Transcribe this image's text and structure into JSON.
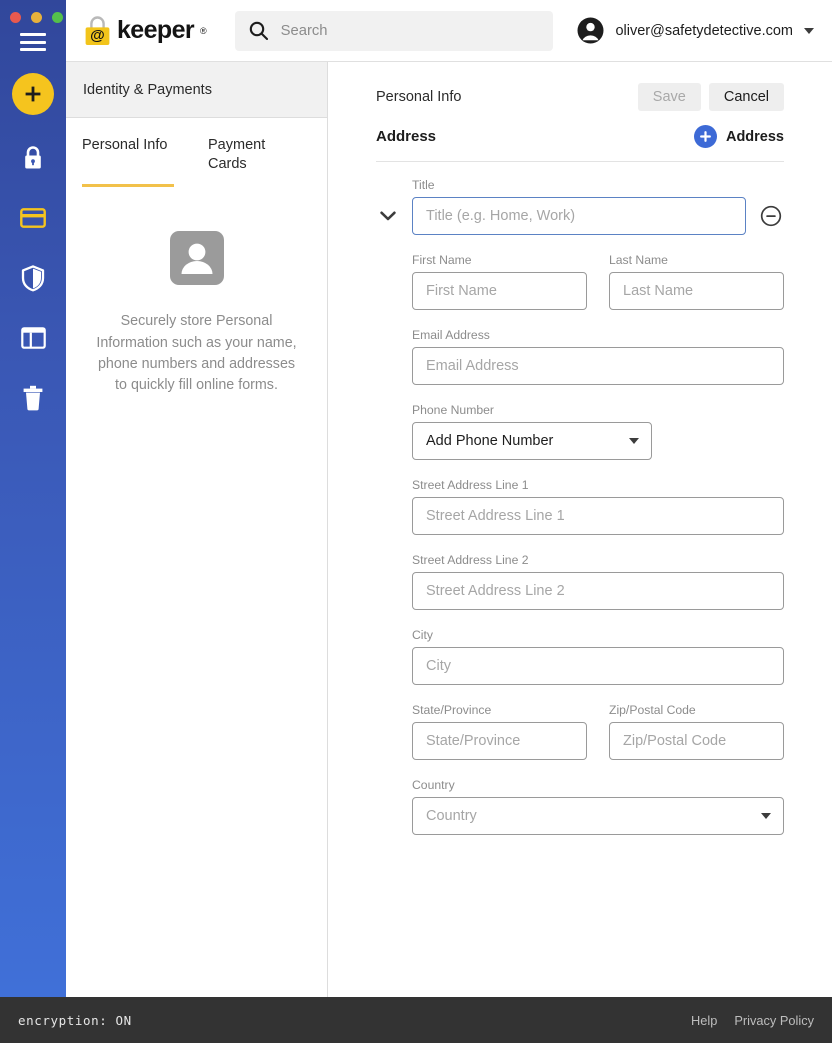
{
  "window": {
    "traffic_lights": [
      "close",
      "minimize",
      "zoom"
    ]
  },
  "topbar": {
    "logo_text": "keeper",
    "logo_registered": "®",
    "logo_icon": "padlock-at-icon",
    "search": {
      "icon": "search-icon",
      "placeholder": "Search",
      "value": ""
    },
    "account": {
      "icon": "user-avatar-icon",
      "email": "oliver@safetydetective.com",
      "caret": "chevron-down-icon"
    }
  },
  "rail": {
    "menu_icon": "hamburger-menu-icon",
    "add_button": {
      "icon": "plus-icon",
      "color": "#f5c41e"
    },
    "items": [
      {
        "icon": "lock-icon",
        "name": "passwords",
        "active": false
      },
      {
        "icon": "credit-card-icon",
        "name": "identity-payments",
        "active": true
      },
      {
        "icon": "shield-icon",
        "name": "security-audit",
        "active": false
      },
      {
        "icon": "dashboard-panel-icon",
        "name": "dashboard",
        "active": false
      },
      {
        "icon": "trash-icon",
        "name": "deleted-items",
        "active": false
      }
    ],
    "accent_color": "#f5c41e"
  },
  "list_panel": {
    "header": "Identity & Payments",
    "tabs": [
      {
        "label": "Personal Info",
        "active": true
      },
      {
        "label": "Payment Cards",
        "active": false
      }
    ],
    "empty_state": {
      "icon": "person-placeholder-icon",
      "text": "Securely store Personal Information such as your name, phone numbers and addresses to quickly fill online forms."
    }
  },
  "detail": {
    "title": "Personal Info",
    "save_label": "Save",
    "save_disabled": true,
    "cancel_label": "Cancel",
    "section_title": "Address",
    "add_label": "Address",
    "add_icon": "plus-circle-icon",
    "collapse_icon": "chevron-down-icon",
    "remove_icon": "minus-circle-icon",
    "accent_blue": "#3d6ad6",
    "fields": {
      "title": {
        "label": "Title",
        "placeholder": "Title (e.g. Home, Work)",
        "value": "",
        "focused": true
      },
      "first_name": {
        "label": "First Name",
        "placeholder": "First Name",
        "value": ""
      },
      "last_name": {
        "label": "Last Name",
        "placeholder": "Last Name",
        "value": ""
      },
      "email": {
        "label": "Email Address",
        "placeholder": "Email Address",
        "value": ""
      },
      "phone": {
        "label": "Phone Number",
        "selected": "Add Phone Number"
      },
      "street1": {
        "label": "Street Address Line 1",
        "placeholder": "Street Address Line 1",
        "value": ""
      },
      "street2": {
        "label": "Street Address Line 2",
        "placeholder": "Street Address Line 2",
        "value": ""
      },
      "city": {
        "label": "City",
        "placeholder": "City",
        "value": ""
      },
      "state": {
        "label": "State/Province",
        "placeholder": "State/Province",
        "value": ""
      },
      "zip": {
        "label": "Zip/Postal Code",
        "placeholder": "Zip/Postal Code",
        "value": ""
      },
      "country": {
        "label": "Country",
        "placeholder": "Country",
        "selected": ""
      }
    }
  },
  "statusbar": {
    "encryption": "encryption: ON",
    "links": [
      {
        "label": "Help"
      },
      {
        "label": "Privacy Policy"
      }
    ]
  }
}
